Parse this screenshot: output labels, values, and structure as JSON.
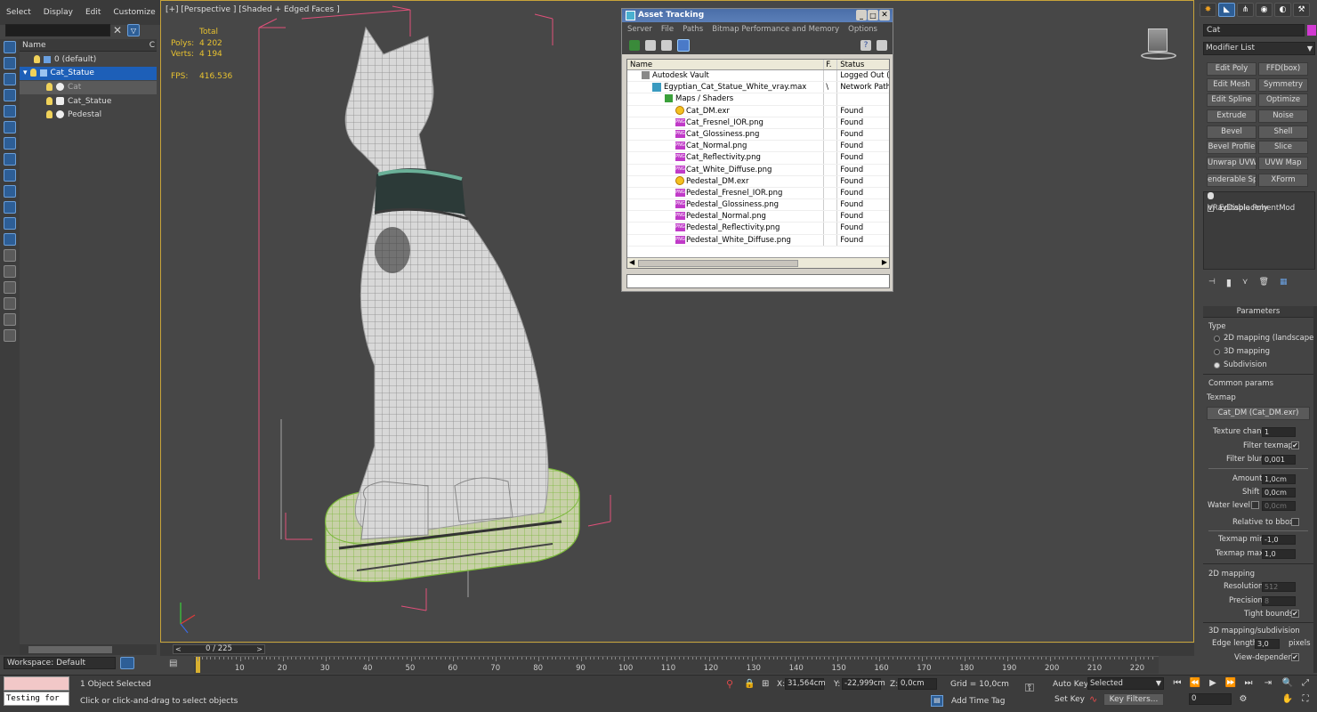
{
  "menu": [
    "Select",
    "Display",
    "Edit",
    "Customize"
  ],
  "explorer": {
    "header_name": "Name",
    "header_col2": "C",
    "items": [
      "0 (default)",
      "Cat_Statue",
      "Cat",
      "Cat_Statue",
      "Pedestal"
    ]
  },
  "workspace": "Workspace: Default",
  "viewport": {
    "label": "[+] [Perspective ] [Shaded + Edged Faces ]",
    "stats": {
      "total_label": "Total",
      "polys_label": "Polys:",
      "polys": "4 202",
      "verts_label": "Verts:",
      "verts": "4 194",
      "fps_label": "FPS:",
      "fps": "416.536"
    }
  },
  "asset_tracking": {
    "title": "Asset Tracking",
    "menu": [
      "Server",
      "File",
      "Paths",
      "Bitmap Performance and Memory",
      "Options"
    ],
    "columns": [
      "Name",
      "F.",
      "Status"
    ],
    "rows": [
      {
        "name": "Autodesk Vault",
        "f": "",
        "status": "Logged Out (..."
      },
      {
        "name": "Egyptian_Cat_Statue_White_vray.max",
        "f": "\\",
        "status": "Network Path"
      },
      {
        "name": "Maps / Shaders",
        "f": "",
        "status": ""
      },
      {
        "name": "Cat_DM.exr",
        "f": "",
        "status": "Found"
      },
      {
        "name": "Cat_Fresnel_IOR.png",
        "f": "",
        "status": "Found"
      },
      {
        "name": "Cat_Glossiness.png",
        "f": "",
        "status": "Found"
      },
      {
        "name": "Cat_Normal.png",
        "f": "",
        "status": "Found"
      },
      {
        "name": "Cat_Reflectivity.png",
        "f": "",
        "status": "Found"
      },
      {
        "name": "Cat_White_Diffuse.png",
        "f": "",
        "status": "Found"
      },
      {
        "name": "Pedestal_DM.exr",
        "f": "",
        "status": "Found"
      },
      {
        "name": "Pedestal_Fresnel_IOR.png",
        "f": "",
        "status": "Found"
      },
      {
        "name": "Pedestal_Glossiness.png",
        "f": "",
        "status": "Found"
      },
      {
        "name": "Pedestal_Normal.png",
        "f": "",
        "status": "Found"
      },
      {
        "name": "Pedestal_Reflectivity.png",
        "f": "",
        "status": "Found"
      },
      {
        "name": "Pedestal_White_Diffuse.png",
        "f": "",
        "status": "Found"
      }
    ]
  },
  "command_panel": {
    "object_name": "Cat",
    "modifier_list": "Modifier List",
    "buttons": [
      "Edit Poly",
      "FFD(box)",
      "Edit Mesh",
      "Symmetry",
      "Edit Spline",
      "Optimize",
      "Extrude",
      "Noise",
      "Bevel",
      "Shell",
      "Bevel Profile",
      "Slice",
      "Unwrap UVW",
      "UVW Map",
      "enderable Splin",
      "XForm"
    ],
    "stack": [
      "VRayDisplacementMod",
      "Editable Poly"
    ],
    "parameters": {
      "title": "Parameters",
      "type_label": "Type",
      "type_options": [
        "2D mapping (landscape)",
        "3D mapping",
        "Subdivision"
      ],
      "common_label": "Common params",
      "texmap_label": "Texmap",
      "texmap_value": "Cat_DM (Cat_DM.exr)",
      "texture_chan_label": "Texture chan",
      "texture_chan": "1",
      "filter_texmap_label": "Filter texmap",
      "filter_blur_label": "Filter blur",
      "filter_blur": "0,001",
      "amount_label": "Amount",
      "amount": "1,0cm",
      "shift_label": "Shift",
      "shift": "0,0cm",
      "water_label": "Water level",
      "water": "0,0cm",
      "relative_label": "Relative to bbox",
      "texmap_min_label": "Texmap min",
      "texmap_min": "-1,0",
      "texmap_max_label": "Texmap max",
      "texmap_max": "1,0",
      "mapping2d_label": "2D mapping",
      "resolution_label": "Resolution",
      "resolution": "512",
      "precision_label": "Precision",
      "precision": "8",
      "tight_label": "Tight bounds",
      "mapping3d_label": "3D mapping/subdivision",
      "edge_label": "Edge length",
      "edge": "3,0",
      "pixels_label": "pixels",
      "view_label": "View-dependent"
    }
  },
  "timeline": {
    "slider": "0 / 225",
    "ticks": [
      "0",
      "10",
      "20",
      "30",
      "40",
      "50",
      "60",
      "70",
      "80",
      "90",
      "100",
      "110",
      "120",
      "130",
      "140",
      "150",
      "160",
      "170",
      "180",
      "190",
      "200",
      "210",
      "220"
    ]
  },
  "status": {
    "maxscript": "Testing for",
    "selected": "1 Object Selected",
    "prompt": "Click or click-and-drag to select objects",
    "x_label": "X:",
    "x": "31,564cm",
    "y_label": "Y:",
    "y": "-22,999cm",
    "z_label": "Z:",
    "z": "0,0cm",
    "grid": "Grid = 10,0cm",
    "add_time_tag": "Add Time Tag",
    "auto_key": "Auto Key",
    "set_key": "Set Key",
    "selected_dropdown": "Selected",
    "key_filters": "Key Filters...",
    "frame": "0"
  },
  "colors": {
    "accent_blue": "#1d5fb8",
    "viewport_border": "#c8a43a",
    "stats_yellow": "#e8c230",
    "wire_pink": "#e0507a"
  }
}
